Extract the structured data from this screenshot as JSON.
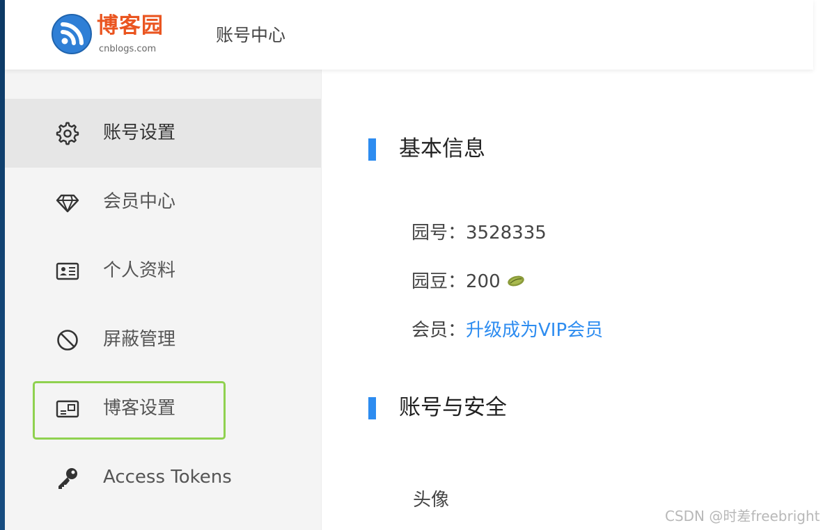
{
  "header": {
    "logo_title": "博客园",
    "logo_subtitle": "cnblogs.com",
    "page_title": "账号中心"
  },
  "sidebar": {
    "items": [
      {
        "label": "账号设置",
        "icon": "gear-icon",
        "active": true
      },
      {
        "label": "会员中心",
        "icon": "diamond-icon",
        "active": false
      },
      {
        "label": "个人资料",
        "icon": "id-card-icon",
        "active": false
      },
      {
        "label": "屏蔽管理",
        "icon": "block-icon",
        "active": false
      },
      {
        "label": "博客设置",
        "icon": "blog-card-icon",
        "active": false,
        "highlighted": true
      },
      {
        "label": "Access Tokens",
        "icon": "key-icon",
        "active": false
      }
    ]
  },
  "main": {
    "basic_info": {
      "title": "基本信息",
      "garden_id_label": "园号：",
      "garden_id_value": "3528335",
      "beans_label": "园豆：",
      "beans_value": "200",
      "member_label": "会员：",
      "member_link": "升级成为VIP会员"
    },
    "security": {
      "title": "账号与安全",
      "avatar_label": "头像"
    }
  },
  "watermark": "CSDN @时差freebright",
  "colors": {
    "accent": "#2d8cf0",
    "brand": "#ea5520",
    "highlight": "#8fd14f"
  }
}
